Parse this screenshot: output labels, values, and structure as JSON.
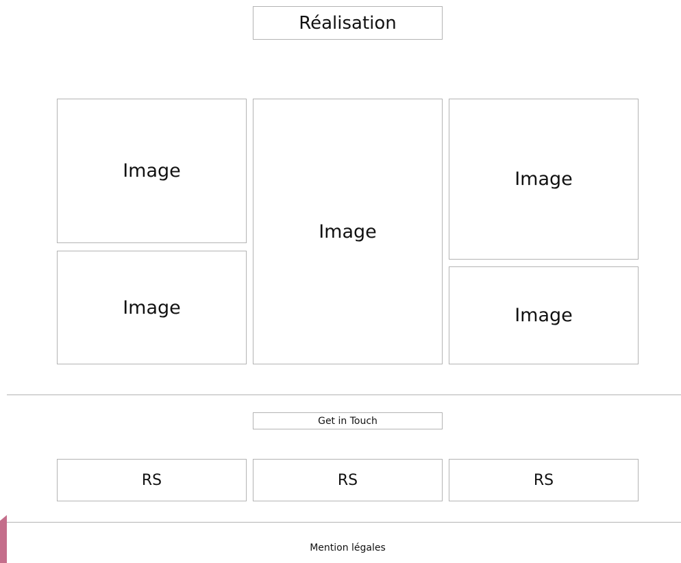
{
  "header": {
    "title": "Réalisation"
  },
  "gallery": {
    "items": [
      {
        "label": "Image"
      },
      {
        "label": "Image"
      },
      {
        "label": "Image"
      },
      {
        "label": "Image"
      },
      {
        "label": "Image"
      }
    ]
  },
  "contact": {
    "cta_label": "Get in Touch"
  },
  "social": {
    "items": [
      {
        "label": "RS"
      },
      {
        "label": "RS"
      },
      {
        "label": "RS"
      }
    ]
  },
  "footer": {
    "legal_label": "Mention légales"
  },
  "colors": {
    "border": "#b3b3b3",
    "accent": "#c46e8b",
    "text": "#111111",
    "background": "#ffffff"
  }
}
